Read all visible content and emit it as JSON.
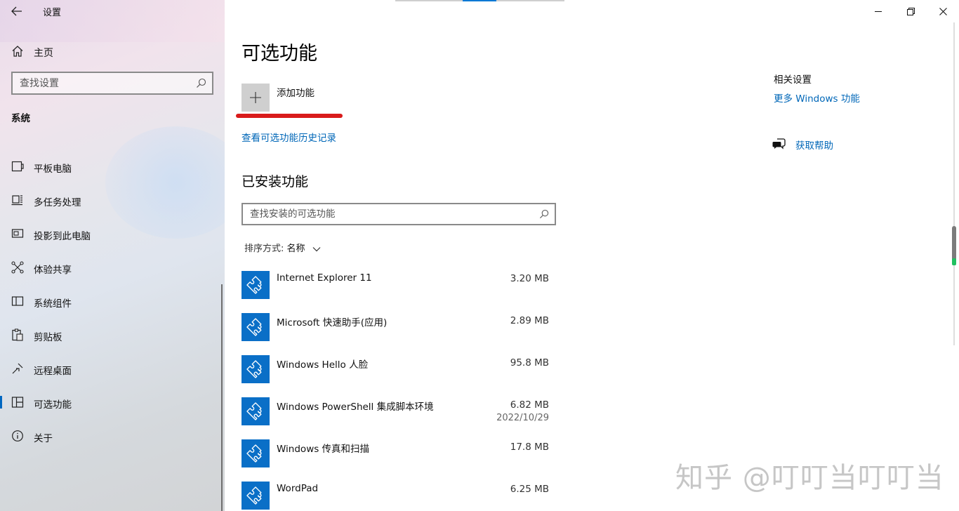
{
  "window": {
    "title": "设置",
    "controls": {
      "minimize": "minimize",
      "restore": "restore",
      "close": "close"
    }
  },
  "sidebar": {
    "home_label": "主页",
    "search_placeholder": "查找设置",
    "section_title": "系统",
    "items": [
      {
        "label": "平板电脑",
        "icon": "tablet-icon",
        "selected": false
      },
      {
        "label": "多任务处理",
        "icon": "multitasking-icon",
        "selected": false
      },
      {
        "label": "投影到此电脑",
        "icon": "project-icon",
        "selected": false
      },
      {
        "label": "体验共享",
        "icon": "shared-experiences-icon",
        "selected": false
      },
      {
        "label": "系统组件",
        "icon": "system-components-icon",
        "selected": false
      },
      {
        "label": "剪贴板",
        "icon": "clipboard-icon",
        "selected": false
      },
      {
        "label": "远程桌面",
        "icon": "remote-desktop-icon",
        "selected": false
      },
      {
        "label": "可选功能",
        "icon": "optional-features-icon",
        "selected": true
      },
      {
        "label": "关于",
        "icon": "info-icon",
        "selected": false
      }
    ]
  },
  "main": {
    "page_title": "可选功能",
    "add_feature_label": "添加功能",
    "history_link": "查看可选功能历史记录",
    "installed_title": "已安装功能",
    "search_placeholder": "查找安装的可选功能",
    "sort_label": "排序方式:",
    "sort_value": "名称",
    "features": [
      {
        "name": "Internet Explorer 11",
        "size": "3.20 MB",
        "date": ""
      },
      {
        "name": "Microsoft 快速助手(应用)",
        "size": "2.89 MB",
        "date": ""
      },
      {
        "name": "Windows Hello 人脸",
        "size": "95.8 MB",
        "date": ""
      },
      {
        "name": "Windows PowerShell 集成脚本环境",
        "size": "6.82 MB",
        "date": "2022/10/29"
      },
      {
        "name": "Windows 传真和扫描",
        "size": "17.8 MB",
        "date": ""
      },
      {
        "name": "WordPad",
        "size": "6.25 MB",
        "date": ""
      }
    ]
  },
  "related": {
    "title": "相关设置",
    "link": "更多 Windows 功能",
    "help_label": "获取帮助"
  },
  "watermark": "知乎 @叮叮当叮叮当",
  "colors": {
    "accent": "#0078d4",
    "link": "#0067b8",
    "feature_icon_bg": "#0a6fc7",
    "annotation_red": "#d91b1b"
  }
}
